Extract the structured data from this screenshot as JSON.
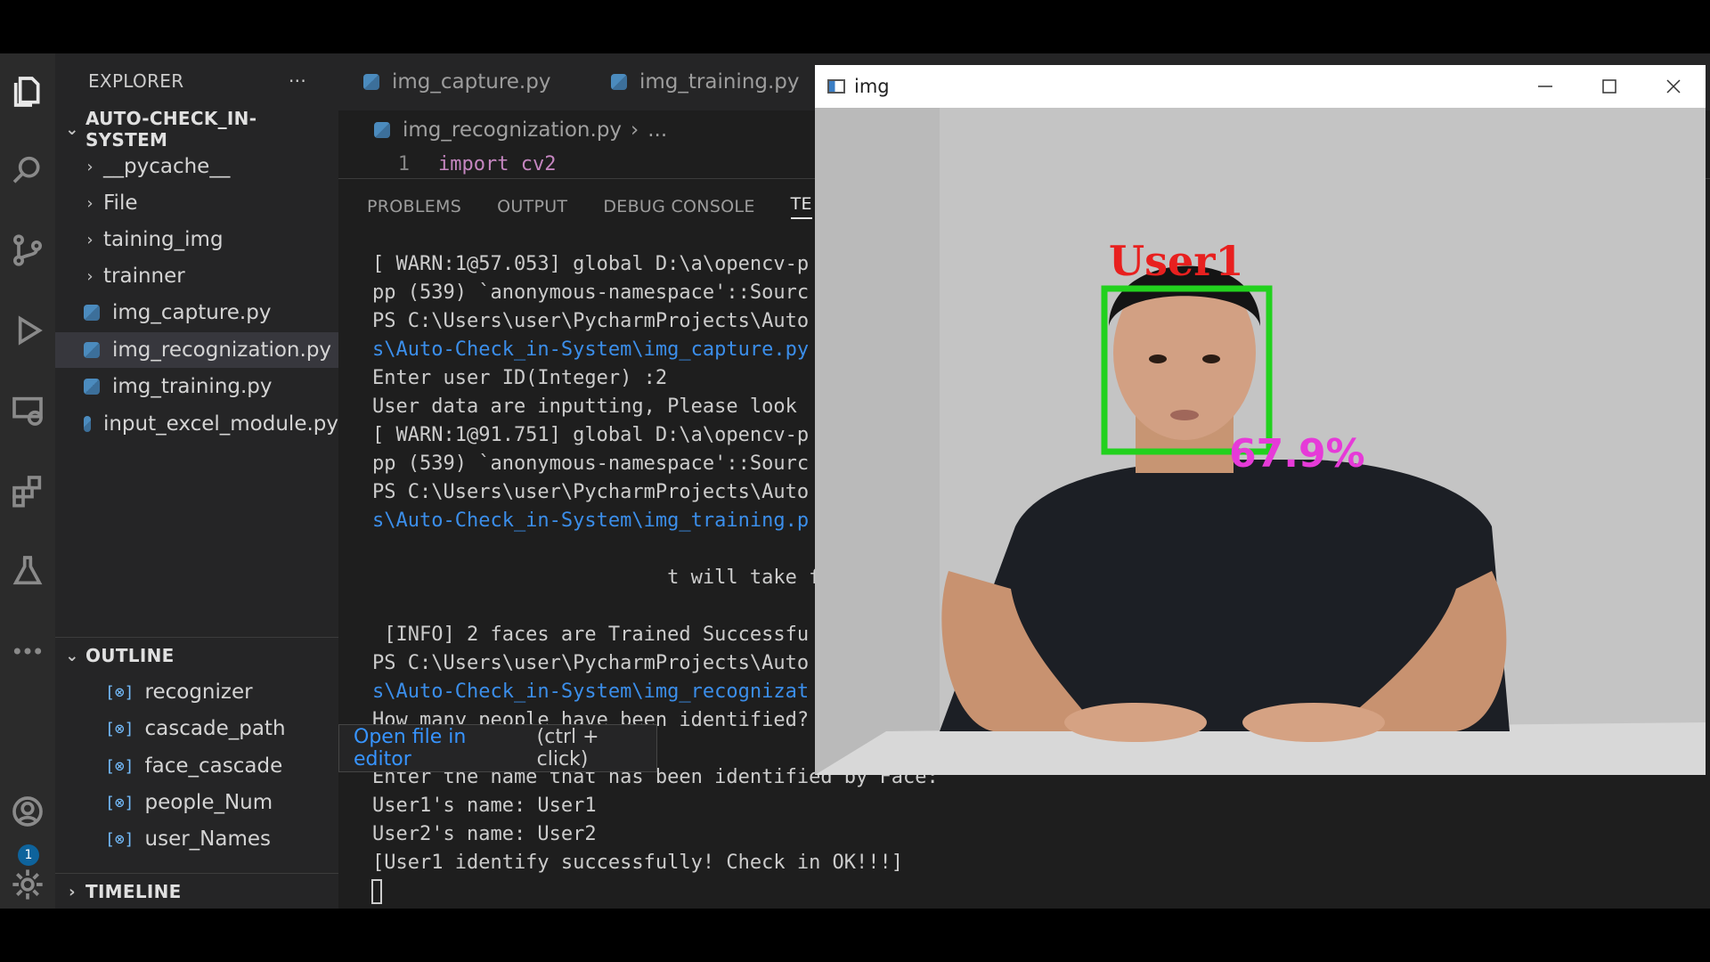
{
  "explorer": {
    "title": "EXPLORER",
    "more": "···",
    "project": "AUTO-CHECK_IN-SYSTEM",
    "folders": [
      "__pycache__",
      "File",
      "taining_img",
      "trainner"
    ],
    "files": [
      "img_capture.py",
      "img_recognization.py",
      "img_training.py",
      "input_excel_module.py"
    ]
  },
  "outline": {
    "title": "OUTLINE",
    "items": [
      "recognizer",
      "cascade_path",
      "face_cascade",
      "people_Num",
      "user_Names"
    ]
  },
  "timeline": {
    "title": "TIMELINE"
  },
  "badge": "1",
  "tabs": [
    "img_capture.py",
    "img_training.py"
  ],
  "breadcrumb": {
    "file": "img_recognization.py",
    "rest": "..."
  },
  "code": {
    "line_no": "1",
    "text": "import cv2"
  },
  "panel_tabs": [
    "PROBLEMS",
    "OUTPUT",
    "DEBUG CONSOLE",
    "TE"
  ],
  "terminal_lines": [
    {
      "text": "[ WARN:1@57.053] global D:\\a\\opencv-p",
      "link": false
    },
    {
      "text": "pp (539) `anonymous-namespace'::Sourc",
      "link": false
    },
    {
      "text": "PS C:\\Users\\user\\PycharmProjects\\Auto",
      "link": false
    },
    {
      "text": "s\\Auto-Check_in-System\\img_capture.py",
      "link": true
    },
    {
      "text": "Enter user ID(Integer) :2",
      "link": false
    },
    {
      "text": "User data are inputting, Please look",
      "link": false
    },
    {
      "text": "[ WARN:1@91.751] global D:\\a\\opencv-p",
      "link": false
    },
    {
      "text": "pp (539) `anonymous-namespace'::Sourc",
      "link": false
    },
    {
      "text": "PS C:\\Users\\user\\PycharmProjects\\Auto",
      "link": false
    },
    {
      "text": "s\\Auto-Check_in-System\\img_training.p",
      "link": true
    },
    {
      "text": "",
      "link": false
    },
    {
      "text": "                         t will take f",
      "link": false
    },
    {
      "text": "",
      "link": false
    },
    {
      "text": " [INFO] 2 faces are Trained Successfu",
      "link": false
    },
    {
      "text": "PS C:\\Users\\user\\PycharmProjects\\Auto",
      "link": false
    },
    {
      "text": "s\\Auto-Check_in-System\\img_recognizat",
      "link": true
    },
    {
      "text": "How many people have been identified?",
      "link": false
    },
    {
      "text": "",
      "link": false
    },
    {
      "text": "Enter the name that has been identified by Face:",
      "link": false
    },
    {
      "text": "User1's name: User1",
      "link": false
    },
    {
      "text": "User2's name: User2",
      "link": false
    },
    {
      "text": "[User1 identify successfully! Check in OK!!!]",
      "link": false
    }
  ],
  "tooltip": {
    "link": "Open file in editor",
    "hint": "(ctrl + click)"
  },
  "imgwindow": {
    "title": "img",
    "label": "User1",
    "confidence": "67.9%",
    "label_color": "#e8201f",
    "box_color": "#22d11e",
    "confidence_color": "#e63ad8"
  }
}
